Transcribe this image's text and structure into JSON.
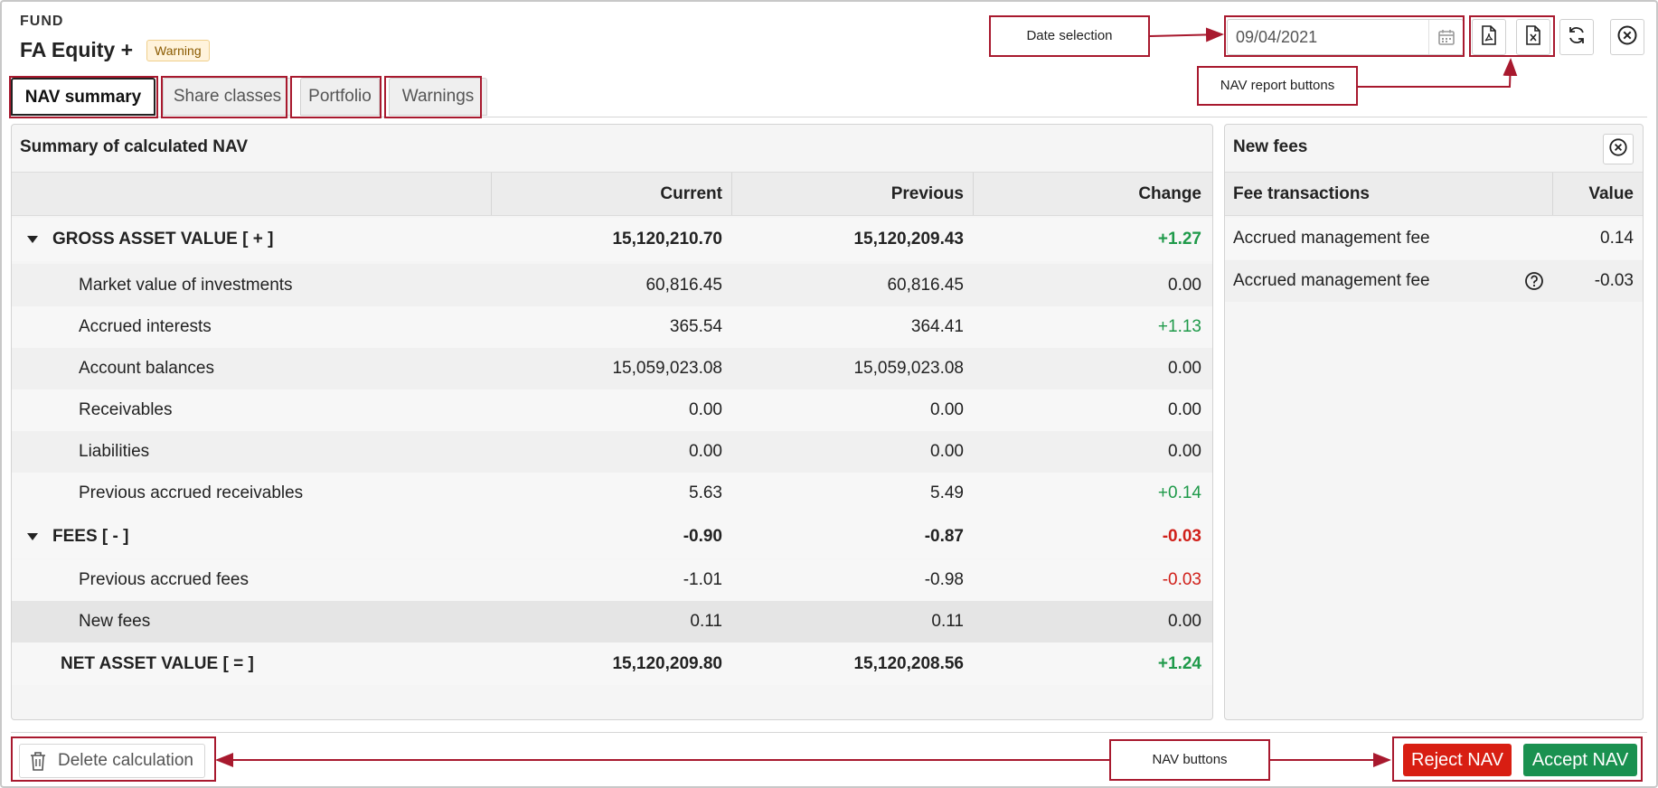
{
  "header": {
    "kicker": "FUND",
    "title": "FA Equity +",
    "badge": "Warning"
  },
  "tabs": [
    {
      "label": "NAV summary",
      "active": true
    },
    {
      "label": "Share classes",
      "active": false
    },
    {
      "label": "Portfolio",
      "active": false
    },
    {
      "label": "Warnings",
      "active": false
    }
  ],
  "toolbar": {
    "date_value": "09/04/2021",
    "icons": [
      "calendar-icon",
      "pdf-file-icon",
      "excel-file-icon",
      "refresh-icon",
      "close-circle-icon"
    ]
  },
  "annotations": {
    "date_selection": "Date selection",
    "report_buttons": "NAV report buttons",
    "nav_buttons": "NAV buttons",
    "color": "#a8192e"
  },
  "summary": {
    "title": "Summary of calculated NAV",
    "columns": [
      "Current",
      "Previous",
      "Change"
    ],
    "rows": [
      {
        "label": "GROSS ASSET VALUE [ + ]",
        "current": "15,120,210.70",
        "previous": "15,120,209.43",
        "change": "+1.27",
        "trend": "pos",
        "bold": true,
        "group": true
      },
      {
        "label": "Market value of investments",
        "current": "60,816.45",
        "previous": "60,816.45",
        "change": "0.00",
        "trend": "neutral"
      },
      {
        "label": "Accrued interests",
        "current": "365.54",
        "previous": "364.41",
        "change": "+1.13",
        "trend": "pos"
      },
      {
        "label": "Account balances",
        "current": "15,059,023.08",
        "previous": "15,059,023.08",
        "change": "0.00",
        "trend": "neutral"
      },
      {
        "label": "Receivables",
        "current": "0.00",
        "previous": "0.00",
        "change": "0.00",
        "trend": "neutral"
      },
      {
        "label": "Liabilities",
        "current": "0.00",
        "previous": "0.00",
        "change": "0.00",
        "trend": "neutral"
      },
      {
        "label": "Previous accrued receivables",
        "current": "5.63",
        "previous": "5.49",
        "change": "+0.14",
        "trend": "pos"
      },
      {
        "label": "FEES [ - ]",
        "current": "-0.90",
        "previous": "-0.87",
        "change": "-0.03",
        "trend": "neg",
        "bold": true,
        "group": true
      },
      {
        "label": "Previous accrued fees",
        "current": "-1.01",
        "previous": "-0.98",
        "change": "-0.03",
        "trend": "neg"
      },
      {
        "label": "New fees",
        "current": "0.11",
        "previous": "0.11",
        "change": "0.00",
        "trend": "neutral",
        "selected": true
      },
      {
        "label": "NET ASSET VALUE [ = ]",
        "current": "15,120,209.80",
        "previous": "15,120,208.56",
        "change": "+1.24",
        "trend": "pos",
        "bold": true,
        "total": true
      }
    ]
  },
  "fees_panel": {
    "title": "New fees",
    "columns": [
      "Fee transactions",
      "Value"
    ],
    "rows": [
      {
        "label": "Accrued management fee",
        "value": "0.14",
        "help": false
      },
      {
        "label": "Accrued management fee",
        "value": "-0.03",
        "help": true
      }
    ]
  },
  "footer": {
    "delete_label": "Delete calculation",
    "reject_label": "Reject NAV",
    "accept_label": "Accept NAV"
  },
  "colors": {
    "positive": "#1f9a4a",
    "negative": "#d0201a",
    "reject": "#d81e12",
    "accept": "#1a9150"
  }
}
